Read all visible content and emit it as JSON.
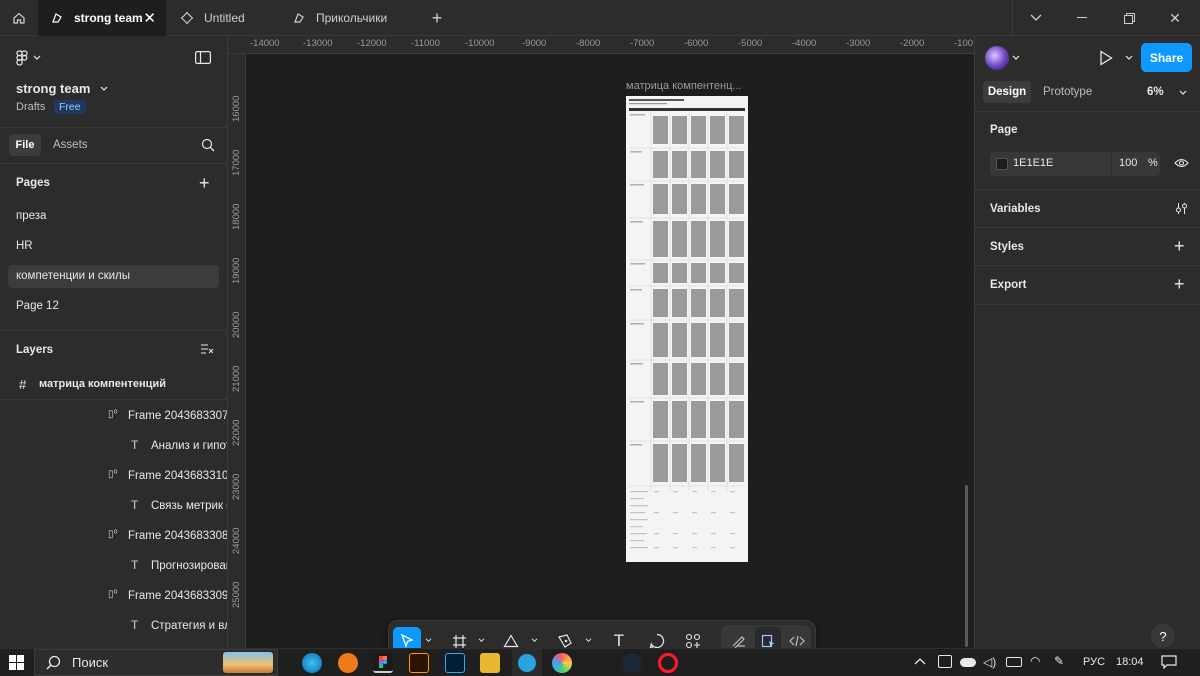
{
  "tabs": [
    {
      "label": "strong team",
      "active": true
    },
    {
      "label": "Untitled",
      "active": false
    },
    {
      "label": "Прикольчики",
      "active": false
    }
  ],
  "team": {
    "name": "strong team",
    "drafts": "Drafts",
    "plan": "Free"
  },
  "left_tabs": {
    "file": "File",
    "assets": "Assets"
  },
  "pages": {
    "title": "Pages",
    "items": [
      "преза",
      "HR",
      "компетенции и скилы",
      "Page 12"
    ]
  },
  "layers": {
    "title": "Layers",
    "root": "матрица компентенций",
    "items": [
      {
        "type": "frame",
        "label": "Frame 2043683307"
      },
      {
        "type": "text",
        "label": "Анализ и гипот"
      },
      {
        "type": "frame",
        "label": "Frame 2043683310"
      },
      {
        "type": "text",
        "label": "Связь метрик с"
      },
      {
        "type": "frame",
        "label": "Frame 2043683308"
      },
      {
        "type": "text",
        "label": "Прогнозирован"
      },
      {
        "type": "frame",
        "label": "Frame 2043683309"
      },
      {
        "type": "text",
        "label": "Стратегия и вл"
      }
    ]
  },
  "ruler_top": [
    "-14000",
    "-13000",
    "-12000",
    "-11000",
    "-10000",
    "-9000",
    "-8000",
    "-7000",
    "-6000",
    "-5000",
    "-4000",
    "-3000",
    "-2000",
    "-100"
  ],
  "ruler_left": [
    "16000",
    "17000",
    "18000",
    "19000",
    "20000",
    "21000",
    "22000",
    "23000",
    "24000",
    "25000"
  ],
  "canvas": {
    "frame_label": "матрица компентенц..."
  },
  "right": {
    "share": "Share",
    "design": "Design",
    "prototype": "Prototype",
    "zoom": "6%",
    "page_title": "Page",
    "page_color": "1E1E1E",
    "page_opacity": "100",
    "percent": "%",
    "variables": "Variables",
    "styles": "Styles",
    "export": "Export",
    "help": "?"
  },
  "taskbar": {
    "search": "Поиск",
    "lang": "РУС",
    "time": "18:04"
  },
  "colors": {
    "accent": "#0d99ff",
    "panel": "#2c2c2c",
    "canvas": "#1e1e1e"
  }
}
